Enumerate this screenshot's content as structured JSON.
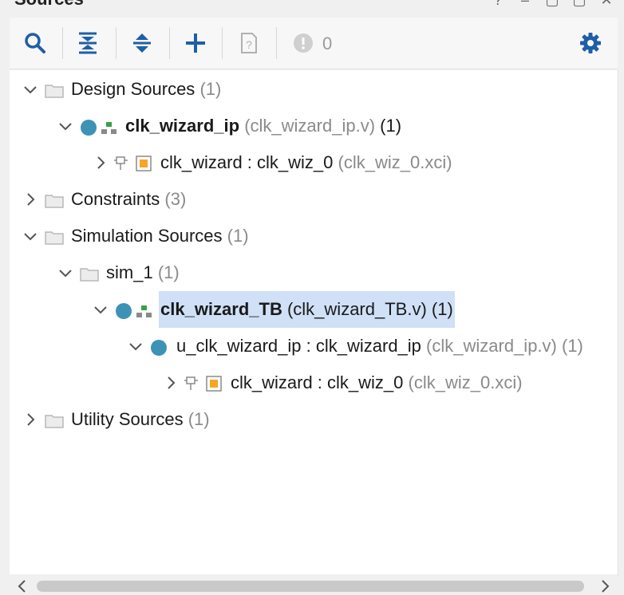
{
  "panel": {
    "title": "Sources"
  },
  "toolbar": {
    "issue_count": "0"
  },
  "tree": {
    "design_sources": {
      "label": "Design Sources",
      "count": "(1)"
    },
    "clk_wizard_ip": {
      "name": "clk_wizard_ip",
      "file": "(clk_wizard_ip.v)",
      "count": "(1)"
    },
    "clk_wizard_1": {
      "inst": "clk_wizard : clk_wiz_0",
      "file": "(clk_wiz_0.xci)"
    },
    "constraints": {
      "label": "Constraints",
      "count": "(3)"
    },
    "sim_sources": {
      "label": "Simulation Sources",
      "count": "(1)"
    },
    "sim_1": {
      "label": "sim_1",
      "count": "(1)"
    },
    "clk_wizard_tb": {
      "name": "clk_wizard_TB",
      "file": "(clk_wizard_TB.v)",
      "count": "(1)"
    },
    "u_clk_wizard_ip": {
      "inst": "u_clk_wizard_ip : clk_wizard_ip",
      "file": "(clk_wizard_ip.v)",
      "count": "(1)"
    },
    "clk_wizard_2": {
      "inst": "clk_wizard : clk_wiz_0",
      "file": "(clk_wiz_0.xci)"
    },
    "utility_sources": {
      "label": "Utility Sources",
      "count": "(1)"
    }
  },
  "colors": {
    "accent": "#1f5ea8",
    "dot": "#3d93b5",
    "selection": "#cfe0f7",
    "ip_orange": "#f5a623"
  }
}
